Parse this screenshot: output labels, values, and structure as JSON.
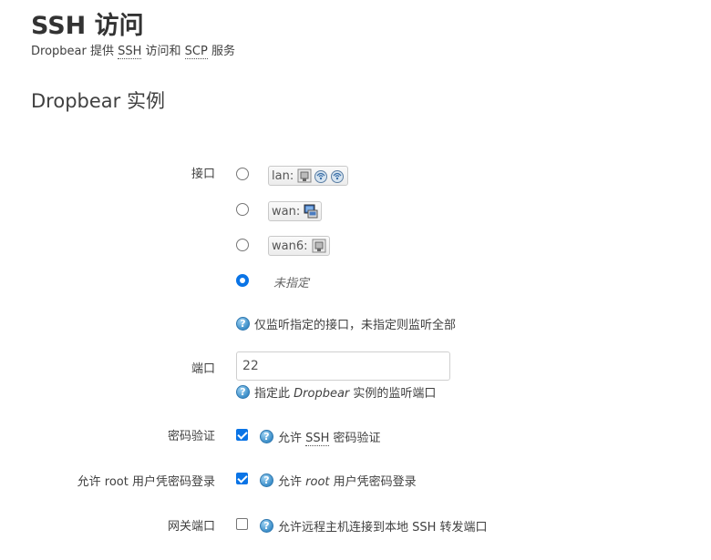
{
  "header": {
    "title": "SSH 访问",
    "desc_prefix": "Dropbear 提供 ",
    "desc_ssh": "SSH",
    "desc_mid": " 访问和 ",
    "desc_scp": "SCP",
    "desc_suffix": " 服务"
  },
  "section": {
    "title": "Dropbear 实例"
  },
  "interface": {
    "label": "接口",
    "options": [
      {
        "name": "lan:",
        "icons": [
          "ethernet-port-icon",
          "wireless-icon",
          "wireless-icon"
        ],
        "selected": false
      },
      {
        "name": "wan:",
        "icons": [
          "network-monitor-icon"
        ],
        "selected": false
      },
      {
        "name": "wan6:",
        "icons": [
          "ethernet-port-icon"
        ],
        "selected": false
      },
      {
        "name": "未指定",
        "icons": [],
        "selected": true
      }
    ],
    "help": "仅监听指定的接口，未指定则监听全部"
  },
  "port": {
    "label": "端口",
    "value": "22",
    "help_prefix": "指定此 ",
    "help_em": "Dropbear",
    "help_suffix": " 实例的监听端口"
  },
  "password_auth": {
    "label": "密码验证",
    "checked": true,
    "help_prefix": "允许 ",
    "help_abbr": "SSH",
    "help_suffix": " 密码验证"
  },
  "root_password": {
    "label": "允许 root 用户凭密码登录",
    "checked": true,
    "help_prefix": "允许 ",
    "help_em": "root",
    "help_suffix": " 用户凭密码登录"
  },
  "gateway_ports": {
    "label": "网关端口",
    "checked": false,
    "help": "允许远程主机连接到本地 SSH 转发端口"
  },
  "help_icon_glyph": "?"
}
